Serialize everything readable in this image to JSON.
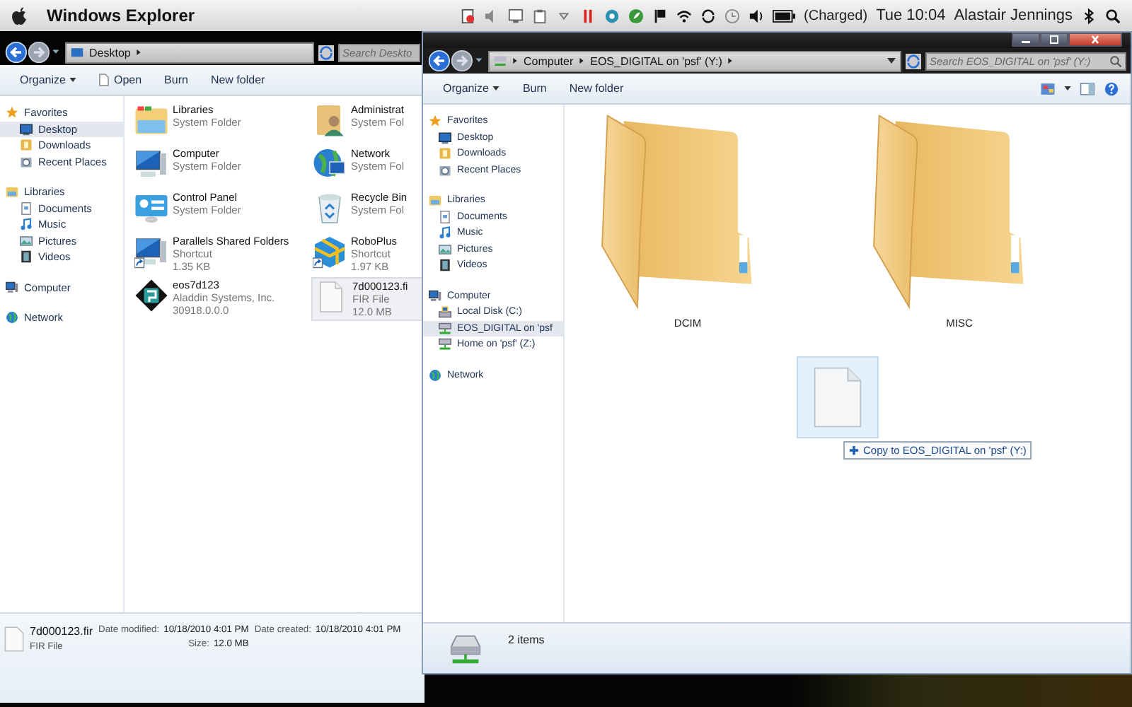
{
  "menu_bar": {
    "app_name": "Windows Explorer",
    "battery_status": "(Charged)",
    "clock": "Tue 10:04",
    "user": "Alastair Jennings"
  },
  "desktop_window": {
    "address": [
      "Desktop"
    ],
    "search": {
      "placeholder": "Search Deskto"
    },
    "toolbar": [
      {
        "label": "Organize",
        "kind": "menu"
      },
      {
        "label": "Open",
        "kind": "open"
      },
      {
        "label": "Burn",
        "kind": "plain"
      },
      {
        "label": "New folder",
        "kind": "plain"
      }
    ],
    "sidebar": [
      {
        "label": "Favorites",
        "kind": "star",
        "selected": false,
        "children": [
          {
            "label": "Desktop",
            "kind": "desktop",
            "selected": true
          },
          {
            "label": "Downloads",
            "kind": "downloads",
            "selected": false
          },
          {
            "label": "Recent Places",
            "kind": "recent",
            "selected": false
          }
        ]
      },
      {
        "label": "Libraries",
        "kind": "libraries",
        "selected": false,
        "children": [
          {
            "label": "Documents",
            "kind": "documents",
            "selected": false
          },
          {
            "label": "Music",
            "kind": "music",
            "selected": false
          },
          {
            "label": "Pictures",
            "kind": "pictures",
            "selected": false
          },
          {
            "label": "Videos",
            "kind": "videos",
            "selected": false
          }
        ]
      },
      {
        "label": "Computer",
        "kind": "computer",
        "selected": false
      },
      {
        "label": "Network",
        "kind": "network",
        "selected": false
      }
    ],
    "files": [
      {
        "name": "Libraries",
        "details": [
          "System Folder"
        ],
        "kind": "libraries",
        "selected": false
      },
      {
        "name": "Administrat",
        "details": [
          "System Fol"
        ],
        "kind": "user_folder",
        "selected": false
      },
      {
        "name": "Computer",
        "details": [
          "System Folder"
        ],
        "kind": "computer",
        "selected": false
      },
      {
        "name": "Network",
        "details": [
          "System Fol"
        ],
        "kind": "network",
        "selected": false
      },
      {
        "name": "Control Panel",
        "details": [
          "System Folder"
        ],
        "kind": "control_panel",
        "selected": false
      },
      {
        "name": "Recycle Bin",
        "details": [
          "System Fol"
        ],
        "kind": "recycle_bin",
        "selected": false
      },
      {
        "name": "Parallels Shared Folders",
        "details": [
          "Shortcut",
          "1.35 KB"
        ],
        "kind": "computer_shortcut",
        "selected": false
      },
      {
        "name": "RoboPlus",
        "details": [
          "Shortcut",
          "1.97 KB"
        ],
        "kind": "box_shortcut",
        "selected": false
      },
      {
        "name": "eos7d123",
        "details": [
          "Aladdin Systems, Inc.",
          "30918.0.0.0"
        ],
        "kind": "app",
        "selected": false
      },
      {
        "name": "7d000123.fi",
        "details": [
          "FIR File",
          "12.0 MB"
        ],
        "kind": "file",
        "selected": true
      }
    ],
    "details_pane": {
      "name": "7d000123.fir",
      "type": "FIR File",
      "fields": [
        {
          "label": "Date modified:",
          "value": "10/18/2010 4:01 PM"
        },
        {
          "label": "Size:",
          "value": "12.0 MB"
        },
        {
          "label": "Date created:",
          "value": "10/18/2010 4:01 PM"
        }
      ]
    }
  },
  "drive_window": {
    "address": [
      "Computer",
      "EOS_DIGITAL on 'psf' (Y:)"
    ],
    "search": {
      "placeholder": "Search EOS_DIGITAL on 'psf' (Y:)"
    },
    "toolbar": [
      {
        "label": "Organize",
        "kind": "menu"
      },
      {
        "label": "Burn",
        "kind": "plain"
      },
      {
        "label": "New folder",
        "kind": "plain"
      }
    ],
    "sidebar": [
      {
        "label": "Favorites",
        "kind": "star",
        "selected": false,
        "children": [
          {
            "label": "Desktop",
            "kind": "desktop",
            "selected": false
          },
          {
            "label": "Downloads",
            "kind": "downloads",
            "selected": false
          },
          {
            "label": "Recent Places",
            "kind": "recent",
            "selected": false
          }
        ]
      },
      {
        "label": "Libraries",
        "kind": "libraries",
        "selected": false,
        "children": [
          {
            "label": "Documents",
            "kind": "documents",
            "selected": false
          },
          {
            "label": "Music",
            "kind": "music",
            "selected": false
          },
          {
            "label": "Pictures",
            "kind": "pictures",
            "selected": false
          },
          {
            "label": "Videos",
            "kind": "videos",
            "selected": false
          }
        ]
      },
      {
        "label": "Computer",
        "kind": "computer",
        "selected": false,
        "children": [
          {
            "label": "Local Disk (C:)",
            "kind": "disk",
            "selected": false
          },
          {
            "label": "EOS_DIGITAL on 'psf",
            "kind": "netdrive",
            "selected": true
          },
          {
            "label": "Home on 'psf' (Z:)",
            "kind": "netdrive",
            "selected": false
          }
        ]
      },
      {
        "label": "Network",
        "kind": "network",
        "selected": false
      }
    ],
    "folders": [
      {
        "name": "DCIM"
      },
      {
        "name": "MISC"
      }
    ],
    "drag_preview": {
      "tooltip": "Copy to EOS_DIGITAL on 'psf' (Y:)"
    },
    "status_bar": {
      "count": "2 items"
    }
  }
}
